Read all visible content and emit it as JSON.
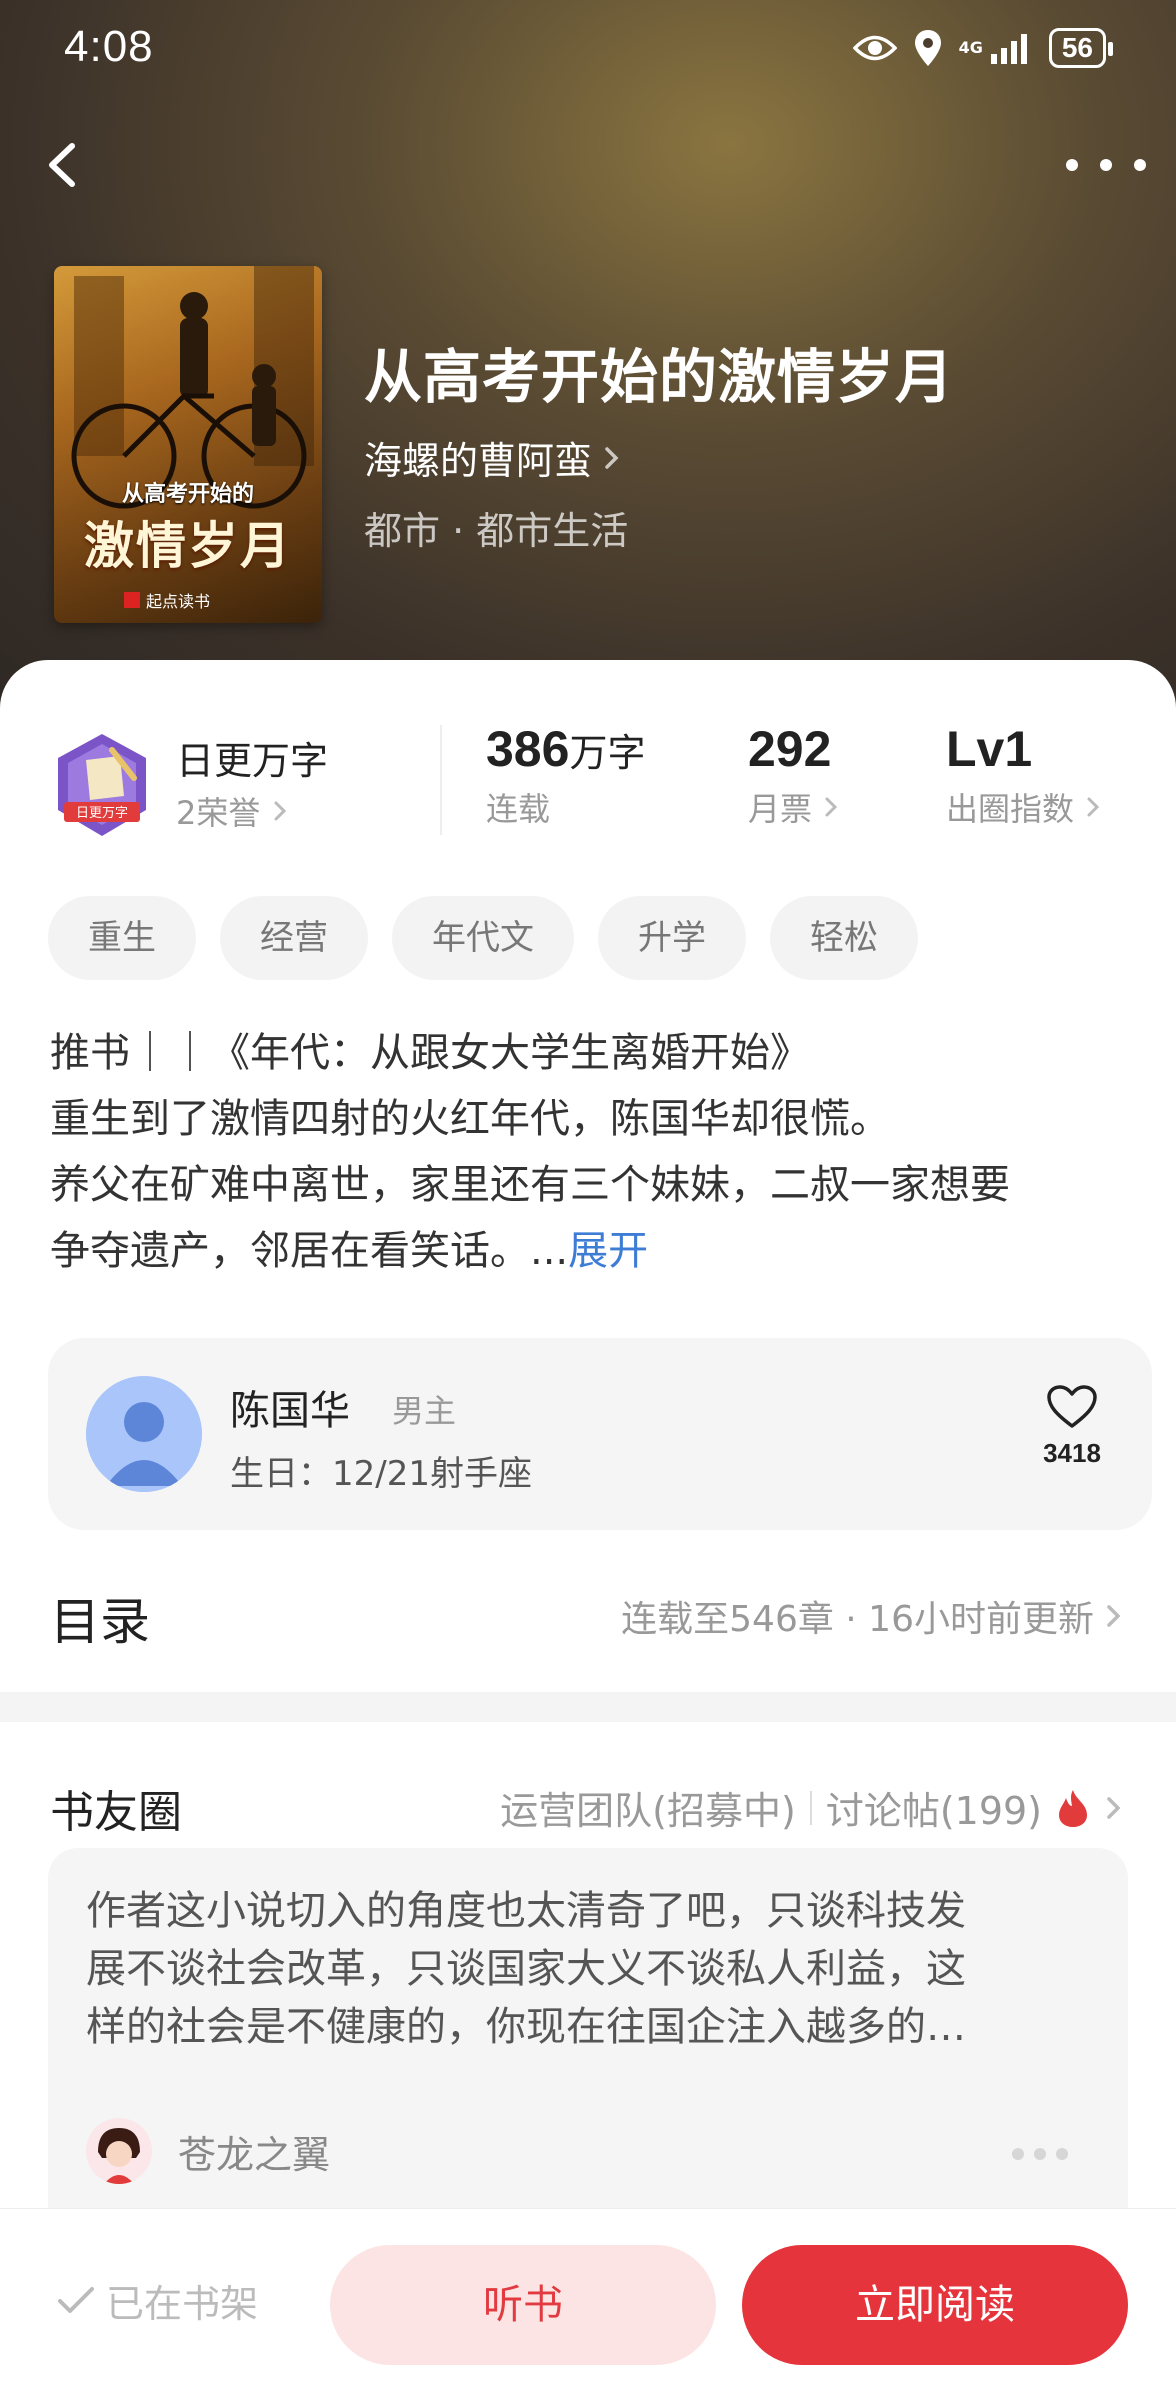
{
  "status_bar": {
    "time": "4:08",
    "network": "4G",
    "battery": "56"
  },
  "book": {
    "title": "从高考开始的激情岁月",
    "author": "海螺的曹阿蛮",
    "genre": "都市 · 都市生活",
    "cover": {
      "subtitle": "从高考开始的",
      "title": "激情岁月",
      "brand": "起点读书"
    }
  },
  "honor": {
    "badge_text": "日更万字",
    "title": "日更万字",
    "count": "2荣誉"
  },
  "stats": [
    {
      "value": "386",
      "unit": "万字",
      "label": "连载",
      "chevron": false
    },
    {
      "value": "292",
      "unit": "",
      "label": "月票",
      "chevron": true
    },
    {
      "value": "Lv1",
      "unit": "",
      "label": "出圈指数",
      "chevron": true
    }
  ],
  "tags": [
    "重生",
    "经营",
    "年代文",
    "升学",
    "轻松"
  ],
  "synopsis": {
    "lines": [
      "推书｜｜《年代：从跟女大学生离婚开始》",
      "重生到了激情四射的火红年代，陈国华却很慌。",
      "养父在矿难中离世，家里还有三个妹妹，二叔一家想要",
      "争夺遗产，邻居在看笑话。..."
    ],
    "expand": "展开"
  },
  "character": {
    "name": "陈国华",
    "role": "男主",
    "birthday": "生日：12/21射手座",
    "likes": "3418"
  },
  "toc": {
    "title": "目录",
    "info": "连载至546章 · 16小时前更新"
  },
  "circle": {
    "title": "书友圈",
    "team": "运营团队(招募中)",
    "posts_label": "讨论帖(199)",
    "post": {
      "lines": [
        "作者这小说切入的角度也太清奇了吧，只谈科技发",
        "展不谈社会改革，只谈国家大义不谈私人利益，这",
        "样的社会是不健康的，你现在往国企注入越多的…"
      ],
      "user": "苍龙之翼"
    }
  },
  "bottom": {
    "shelf": "已在书架",
    "listen": "听书",
    "read": "立即阅读"
  },
  "colors": {
    "accent": "#e6343c",
    "link": "#3e7dd6"
  }
}
